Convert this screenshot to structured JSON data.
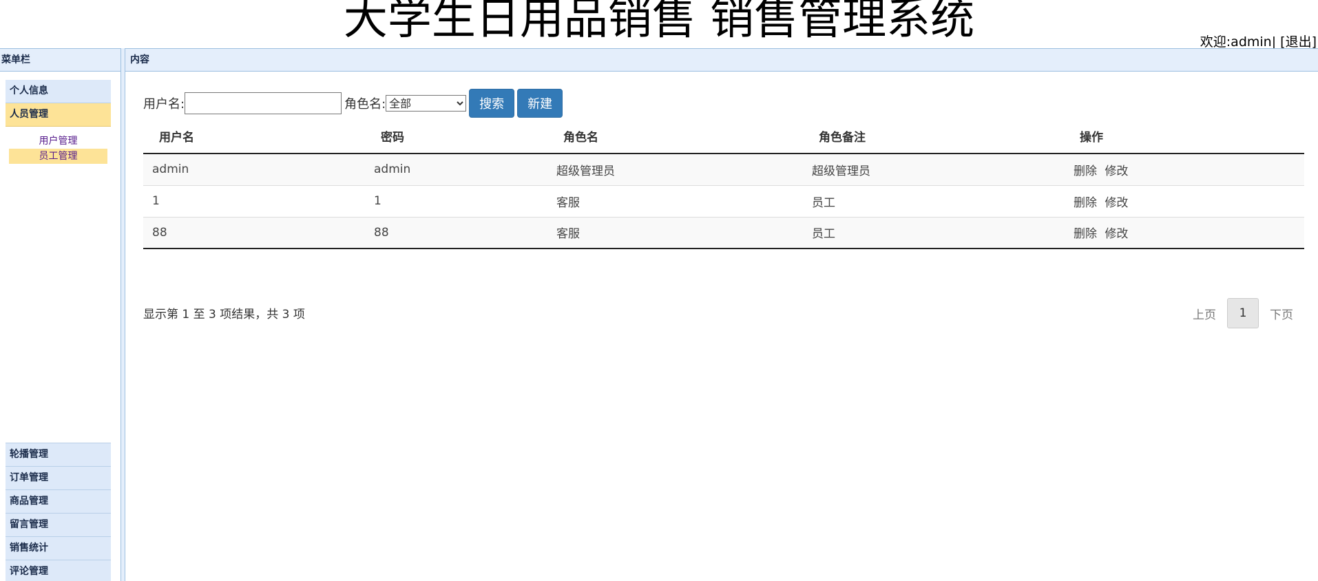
{
  "header": {
    "title": "大学生日用品销售 销售管理系统",
    "welcome": "欢迎:admin|",
    "logout": "[退出]"
  },
  "sidebar": {
    "title": "菜单栏",
    "top_items": [
      {
        "label": "个人信息",
        "active": false
      },
      {
        "label": "人员管理",
        "active": true
      }
    ],
    "sub_items": [
      {
        "label": "用户管理",
        "active": false
      },
      {
        "label": "员工管理",
        "active": true
      }
    ],
    "bottom_items": [
      {
        "label": "轮播管理"
      },
      {
        "label": "订单管理"
      },
      {
        "label": "商品管理"
      },
      {
        "label": "留言管理"
      },
      {
        "label": "销售统计"
      },
      {
        "label": "评论管理"
      }
    ]
  },
  "content": {
    "title": "内容",
    "search": {
      "username_label": "用户名:",
      "username_value": "",
      "role_label": "角色名:",
      "role_selected": "全部",
      "search_button": "搜索",
      "new_button": "新建"
    },
    "table": {
      "columns": [
        "用户名",
        "密码",
        "角色名",
        "角色备注",
        "操作"
      ],
      "rows": [
        {
          "username": "admin",
          "password": "admin",
          "role": "超级管理员",
          "note": "超级管理员"
        },
        {
          "username": "1",
          "password": "1",
          "role": "客服",
          "note": "员工"
        },
        {
          "username": "88",
          "password": "88",
          "role": "客服",
          "note": "员工"
        }
      ],
      "action_delete": "删除",
      "action_edit": "修改"
    },
    "footer_info": "显示第 1 至 3 项结果，共 3 项",
    "pager": {
      "prev": "上页",
      "current": "1",
      "next": "下页"
    }
  }
}
